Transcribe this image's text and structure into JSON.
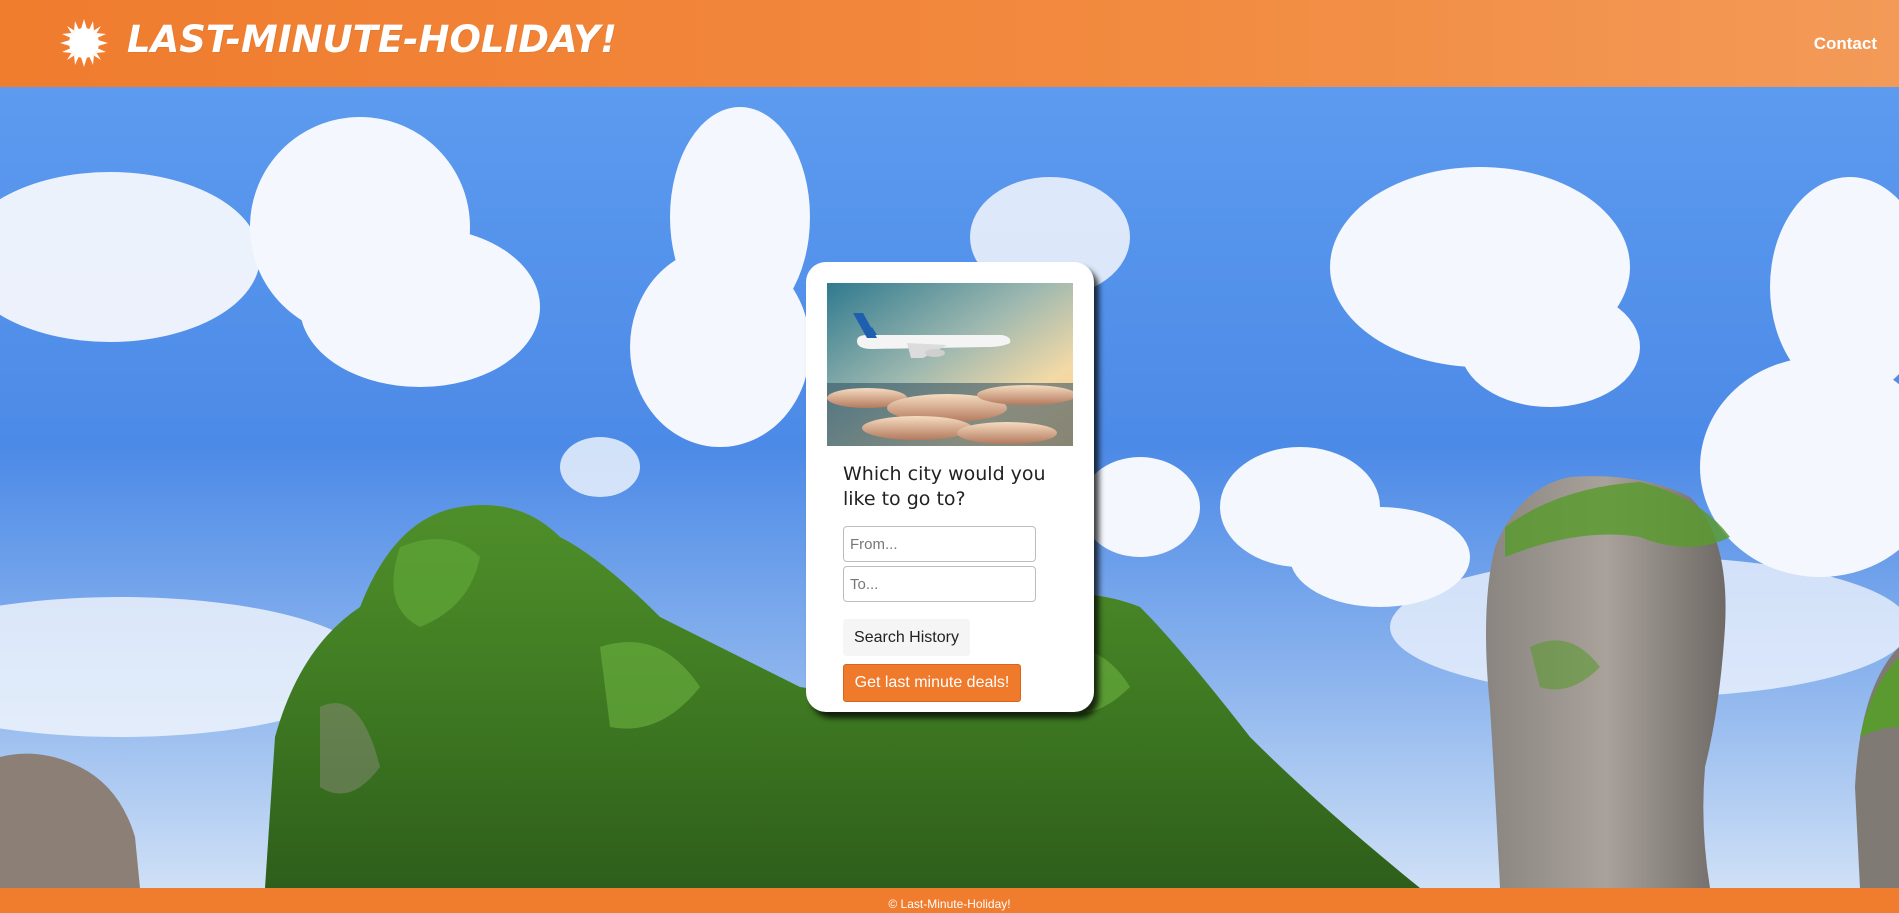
{
  "header": {
    "brand": "LAST-MINUTE-HOLIDAY!",
    "logo_icon": "sun-icon",
    "nav": {
      "contact_label": "Contact"
    }
  },
  "hero": {
    "background": "sky-and-limestone-cliffs-photo"
  },
  "search_card": {
    "image": "airplane-above-clouds-photo",
    "question": "Which city would you like to go to?",
    "from": {
      "value": "",
      "placeholder": "From..."
    },
    "to": {
      "value": "",
      "placeholder": "To..."
    },
    "history_button": "Search History",
    "deals_button": "Get last minute deals!"
  },
  "footer": {
    "copyright": "© Last-Minute-Holiday!"
  },
  "colors": {
    "brand_orange": "#f07c2e",
    "sky_blue": "#4f8ee8",
    "white": "#ffffff"
  }
}
